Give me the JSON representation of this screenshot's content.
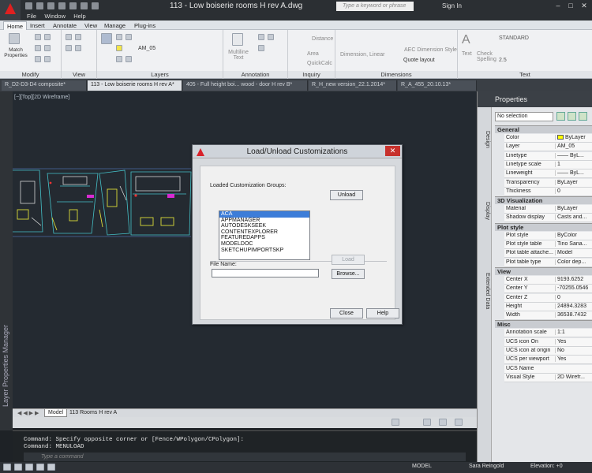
{
  "title_bar": {
    "document_title": "113 - Low boiserie rooms H rev A.dwg",
    "search_placeholder": "Type a keyword or phrase",
    "sign_in": "Sign In",
    "minimize": "–",
    "maximize": "□",
    "close": "✕"
  },
  "menu_bar": {
    "items": [
      "File",
      "Window",
      "Help"
    ]
  },
  "ribbon": {
    "tabs": [
      "Home",
      "Insert",
      "Annotate",
      "View",
      "Manage",
      "Plug-ins"
    ],
    "active_tab": "Home",
    "panels": [
      "Modify",
      "View",
      "Layers",
      "Annotation",
      "Inquiry",
      "Dimensions",
      "Text"
    ],
    "labels": {
      "match_properties": "Match Properties",
      "layer_value": "AM_05",
      "multiline_text": "Multiline Text",
      "distance": "Distance",
      "area": "Area",
      "quickcalc": "QuickCalc",
      "dimension_linear": "Dimension, Linear",
      "aec_dimension_style": "AEC Dimension Style",
      "quote_layout": "Quote layout",
      "text": "Text",
      "check_spelling": "Check Spelling",
      "text_style": "STANDARD",
      "text_height": "2.5"
    }
  },
  "doc_tabs": [
    {
      "label": "R_D2-D3-D4 composite*",
      "active": false
    },
    {
      "label": "113 - Low boiserie rooms H rev A*",
      "active": true
    },
    {
      "label": "405 - Full height boi... wood - door H rev B*",
      "active": false
    },
    {
      "label": "R_H_new version_22.1.2014*",
      "active": false
    },
    {
      "label": "R_A_455_20.10.13*",
      "active": false
    }
  ],
  "viewport": {
    "label": "[−][Top][2D Wireframe]"
  },
  "left_strip": {
    "label": "Layer Properties Manager"
  },
  "model_tabs": [
    "Model",
    "113 Rooms H rev A"
  ],
  "command": {
    "line1": "Command: Specify opposite corner or [Fence/WPolygon/CPolygon]:",
    "line2": "Command: MENULOAD",
    "placeholder": "Type a command"
  },
  "status": {
    "model": "MODEL",
    "user": "Sara Reingold",
    "elevation": "Elevation: +0"
  },
  "properties": {
    "title": "Properties",
    "selection": "No selection",
    "side_tabs": [
      "Design",
      "Display",
      "Extended Data"
    ],
    "sections": [
      {
        "name": "General",
        "rows": [
          {
            "k": "Color",
            "v": "ByLayer",
            "swatch": "#ffff00"
          },
          {
            "k": "Layer",
            "v": "AM_05"
          },
          {
            "k": "Linetype",
            "v": "—— ByL..."
          },
          {
            "k": "Linetype scale",
            "v": "1"
          },
          {
            "k": "Lineweight",
            "v": "—— ByL..."
          },
          {
            "k": "Transparency",
            "v": "ByLayer"
          },
          {
            "k": "Thickness",
            "v": "0"
          }
        ]
      },
      {
        "name": "3D Visualization",
        "rows": [
          {
            "k": "Material",
            "v": "ByLayer"
          },
          {
            "k": "Shadow display",
            "v": "Casts and..."
          }
        ]
      },
      {
        "name": "Plot style",
        "rows": [
          {
            "k": "Plot style",
            "v": "ByColor"
          },
          {
            "k": "Plot style table",
            "v": "Tino Sana..."
          },
          {
            "k": "Plot table attache...",
            "v": "Model"
          },
          {
            "k": "Plot table type",
            "v": "Color dep..."
          }
        ]
      },
      {
        "name": "View",
        "rows": [
          {
            "k": "Center X",
            "v": "9193.6252"
          },
          {
            "k": "Center Y",
            "v": "-70255.0546"
          },
          {
            "k": "Center Z",
            "v": "0"
          },
          {
            "k": "Height",
            "v": "24894.3283"
          },
          {
            "k": "Width",
            "v": "36538.7432"
          }
        ]
      },
      {
        "name": "Misc",
        "rows": [
          {
            "k": "Annotation scale",
            "v": "1:1"
          },
          {
            "k": "UCS icon On",
            "v": "Yes"
          },
          {
            "k": "UCS icon at origin",
            "v": "No"
          },
          {
            "k": "UCS per viewport",
            "v": "Yes"
          },
          {
            "k": "UCS Name",
            "v": ""
          },
          {
            "k": "Visual Style",
            "v": "2D Wirefr..."
          }
        ]
      }
    ]
  },
  "dialog": {
    "title": "Load/Unload Customizations",
    "groups_label": "Loaded Customization Groups:",
    "groups": [
      "ACA",
      "APPMANAGER",
      "AUTODESKSEEK",
      "CONTENTEXPLORER",
      "FEATUREDAPPS",
      "MODELDOC",
      "SKETCHUPIMPORTSKP"
    ],
    "selected_group": "ACA",
    "unload_btn": "Unload",
    "load_btn": "Load",
    "file_name_label": "File Name:",
    "file_name_value": "",
    "browse_btn": "Browse...",
    "close_btn": "Close",
    "help_btn": "Help",
    "close_x": "✕"
  },
  "colors": {
    "canvas": "#242a31",
    "accent": "#3d7dd8",
    "close_red": "#c7312c"
  }
}
